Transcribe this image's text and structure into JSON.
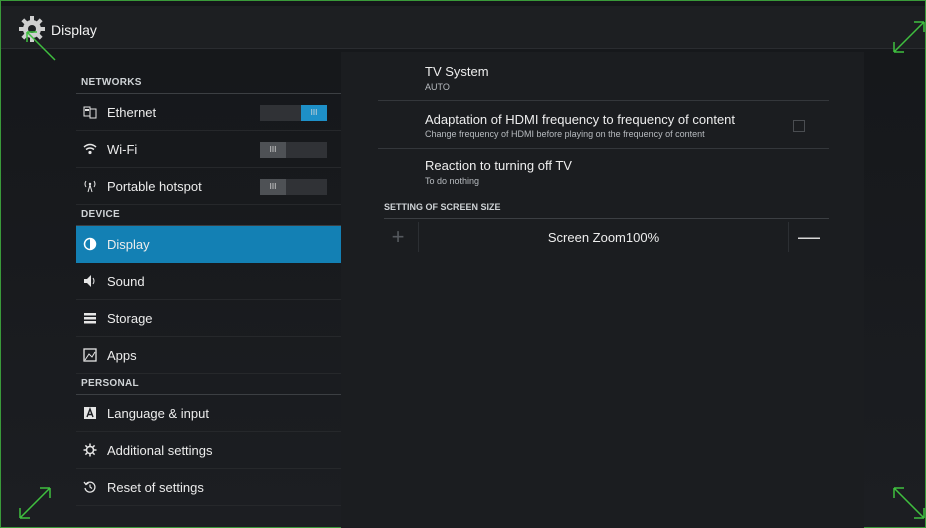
{
  "window": {
    "title": "Display"
  },
  "sidebar": {
    "sections": [
      {
        "header": "NETWORKS",
        "items": [
          {
            "label": "Ethernet",
            "icon": "ethernet-icon",
            "toggle": "on"
          },
          {
            "label": "Wi-Fi",
            "icon": "wifi-icon",
            "toggle": "off"
          },
          {
            "label": "Portable hotspot",
            "icon": "hotspot-icon",
            "toggle": "off"
          }
        ]
      },
      {
        "header": "DEVICE",
        "items": [
          {
            "label": "Display",
            "icon": "display-icon",
            "selected": true
          },
          {
            "label": "Sound",
            "icon": "speaker-icon"
          },
          {
            "label": "Storage",
            "icon": "storage-icon"
          },
          {
            "label": "Apps",
            "icon": "apps-icon"
          }
        ]
      },
      {
        "header": "PERSONAL",
        "items": [
          {
            "label": "Language & input",
            "icon": "keyboard-icon"
          },
          {
            "label": "Additional settings",
            "icon": "gear-icon"
          },
          {
            "label": "Reset of settings",
            "icon": "restore-icon"
          }
        ]
      }
    ],
    "toggle_glyph": "III"
  },
  "display": {
    "tv_system": {
      "title": "TV System",
      "summary": "AUTO"
    },
    "hdmi_adapt": {
      "title": "Adaptation of HDMI frequency to frequency of content",
      "summary": "Change frequency of HDMI before playing on the frequency of content",
      "checked": false
    },
    "reaction_off": {
      "title": "Reaction to turning off TV",
      "summary": "To do nothing"
    },
    "screen_size_header": "SETTING OF SCREEN SIZE",
    "zoom": {
      "label": "Screen Zoom100%",
      "plus": "+",
      "minus": "—"
    }
  },
  "colors": {
    "accent": "#1380b4",
    "frame": "#3a9a3a",
    "toggle_on": "#1e90c8"
  }
}
